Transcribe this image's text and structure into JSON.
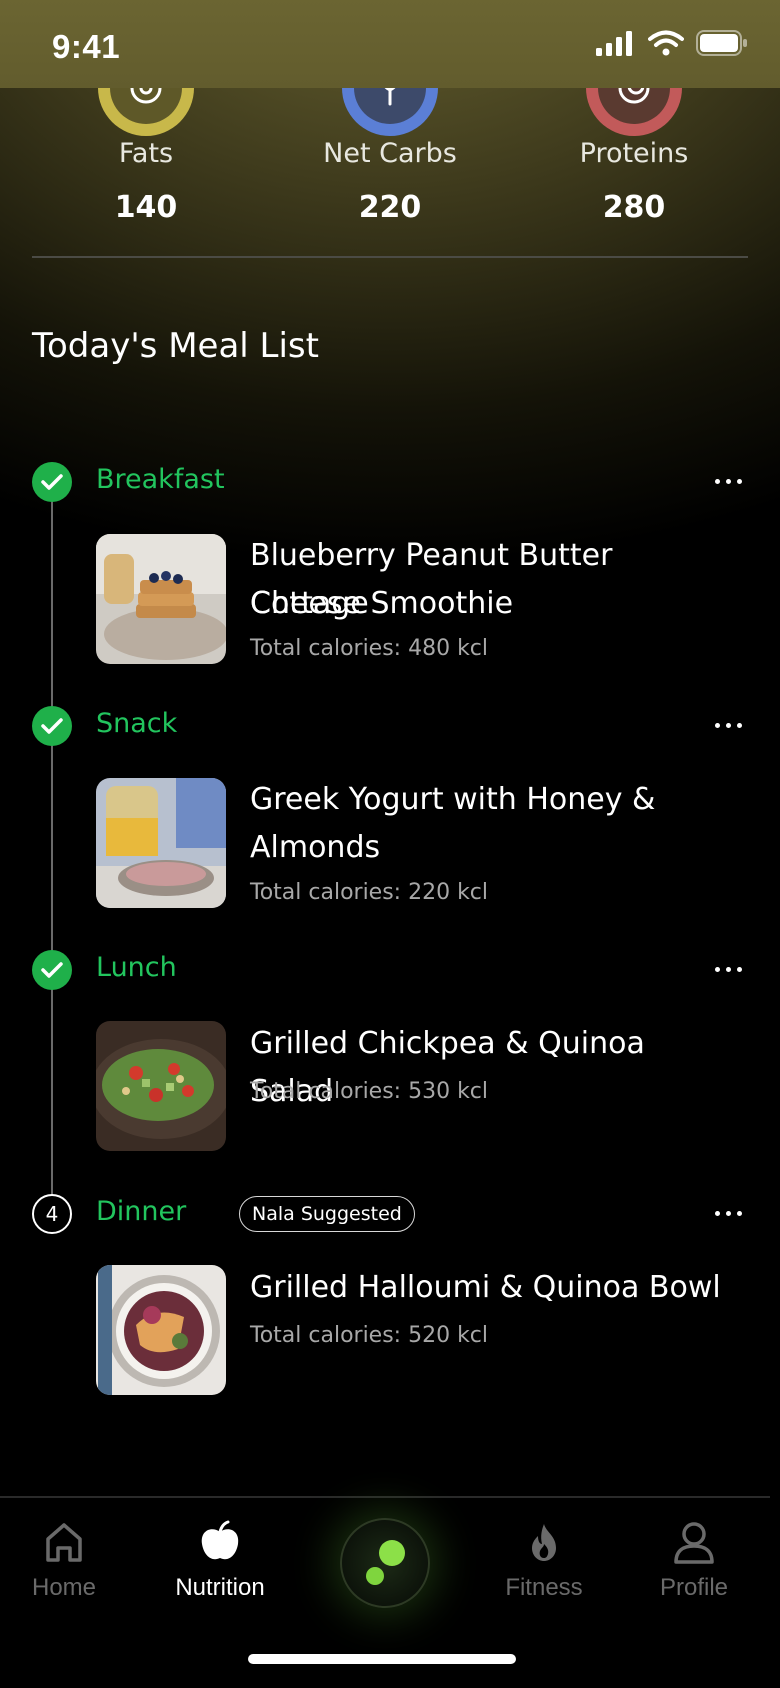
{
  "status_bar": {
    "time": "9:41"
  },
  "macros": [
    {
      "label": "Fats",
      "value": "140",
      "color": "#c8b84a",
      "icon": "fat-drop-icon"
    },
    {
      "label": "Net Carbs",
      "value": "220",
      "color": "#5b7fd6",
      "icon": "wheat-icon"
    },
    {
      "label": "Proteins",
      "value": "280",
      "color": "#c25a5a",
      "icon": "protein-icon"
    }
  ],
  "section_title": "Today's Meal List",
  "meals": [
    {
      "type": "Breakfast",
      "status": "done",
      "name_line1": "Blueberry Peanut Butter Cottage",
      "name_line2": "Cheese Smoothie",
      "calories": "Total calories: 480 kcl"
    },
    {
      "type": "Snack",
      "status": "done",
      "name_line1": "Greek Yogurt with Honey &",
      "name_line2": "Almonds",
      "calories": "Total calories: 220 kcl"
    },
    {
      "type": "Lunch",
      "status": "done",
      "name_line1": "Grilled Chickpea & Quinoa Salad",
      "calories": "Total calories: 530 kcl"
    },
    {
      "type": "Dinner",
      "status": "pending",
      "step": "4",
      "badge": "Nala Suggested",
      "name_line1": "Grilled Halloumi & Quinoa Bowl",
      "calories": "Total calories: 520 kcl"
    }
  ],
  "nav": {
    "home": "Home",
    "nutrition": "Nutrition",
    "fitness": "Fitness",
    "profile": "Profile",
    "active": "Nutrition"
  },
  "colors": {
    "accent_green": "#22c55e",
    "check_green": "#1fb04a",
    "background": "#000000"
  }
}
